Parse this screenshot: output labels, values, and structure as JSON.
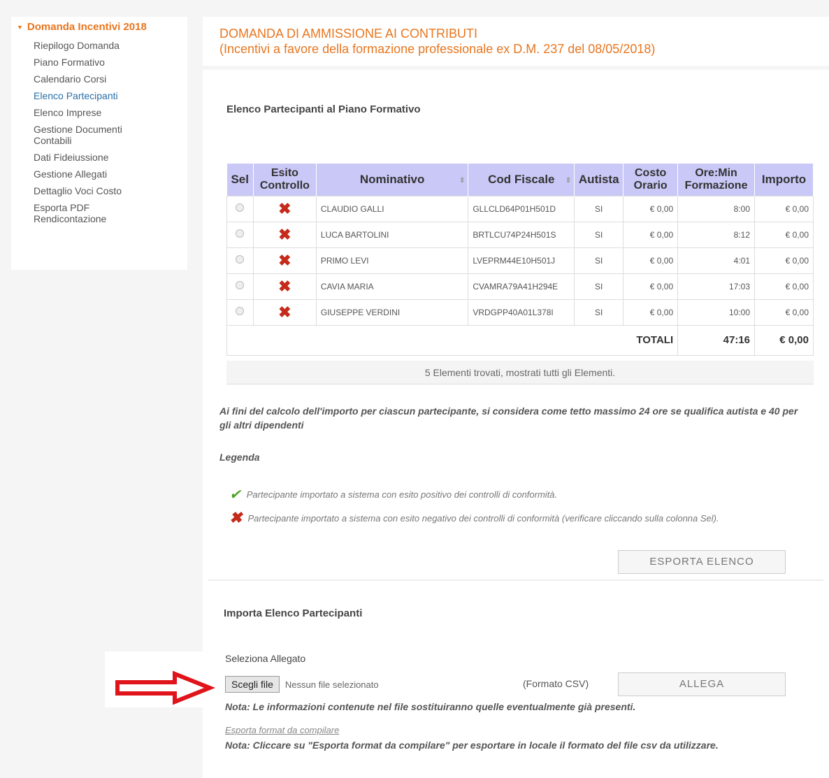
{
  "sidebar": {
    "group_title": "Domanda Incentivi 2018",
    "items": [
      {
        "label": "Riepilogo Domanda"
      },
      {
        "label": "Piano Formativo"
      },
      {
        "label": "Calendario Corsi"
      },
      {
        "label": "Elenco Partecipanti"
      },
      {
        "label": "Elenco Imprese"
      },
      {
        "label": "Gestione Documenti Contabili"
      },
      {
        "label": "Dati Fideiussione"
      },
      {
        "label": "Gestione Allegati"
      },
      {
        "label": "Dettaglio Voci Costo"
      },
      {
        "label": "Esporta PDF Rendicontazione"
      }
    ],
    "active_item": "Elenco Partecipanti"
  },
  "header": {
    "title_line1": "DOMANDA DI AMMISSIONE AI CONTRIBUTI",
    "title_line2": "(Incentivi a favore della formazione professionale ex D.M. 237 del 08/05/2018)"
  },
  "participants": {
    "section_title": "Elenco Partecipanti al Piano Formativo",
    "columns": [
      "Sel",
      "Esito Controllo",
      "Nominativo",
      "Cod Fiscale",
      "Autista",
      "Costo Orario",
      "Ore:Min Formazione",
      "Importo"
    ],
    "rows": [
      {
        "nominativo": "CLAUDIO GALLI",
        "cod_fiscale": "GLLCLD64P01H501D",
        "autista": "SI",
        "costo": "€ 0,00",
        "ore": "8:00",
        "importo": "€ 0,00"
      },
      {
        "nominativo": "LUCA BARTOLINI",
        "cod_fiscale": "BRTLCU74P24H501S",
        "autista": "SI",
        "costo": "€ 0,00",
        "ore": "8:12",
        "importo": "€ 0,00"
      },
      {
        "nominativo": "PRIMO LEVI",
        "cod_fiscale": "LVEPRM44E10H501J",
        "autista": "SI",
        "costo": "€ 0,00",
        "ore": "4:01",
        "importo": "€ 0,00"
      },
      {
        "nominativo": "CAVIA MARIA",
        "cod_fiscale": "CVAMRA79A41H294E",
        "autista": "SI",
        "costo": "€ 0,00",
        "ore": "17:03",
        "importo": "€ 0,00"
      },
      {
        "nominativo": "GIUSEPPE VERDINI",
        "cod_fiscale": "VRDGPP40A01L378I",
        "autista": "SI",
        "costo": "€ 0,00",
        "ore": "10:00",
        "importo": "€ 0,00"
      }
    ],
    "esito_icon": "x-mark-icon",
    "totals_label": "TOTALI",
    "totals_ore": "47:16",
    "totals_importo": "€ 0,00",
    "found_text": "5 Elementi trovati, mostrati tutti gli Elementi."
  },
  "notes": {
    "calc_note": "Ai fini del calcolo dell'importo per ciascun partecipante, si considera come tetto massimo 24 ore se qualifica autista e 40 per gli altri dipendenti",
    "legenda_label": "Legenda",
    "legend_positive": "Partecipante importato a sistema con esito positivo dei controlli di conformità.",
    "legend_negative": "Partecipante importato a sistema con esito negativo dei controlli di conformità (verificare cliccando sulla colonna Sel).",
    "export_button": "ESPORTA ELENCO"
  },
  "import": {
    "section_title": "Importa Elenco Partecipanti",
    "select_label": "Seleziona Allegato",
    "file_button": "Scegli file",
    "file_status": "Nessun file selezionato",
    "format_label": "(Formato CSV)",
    "attach_button": "ALLEGA",
    "replace_note": "Nota: Le informazioni contenute nel file sostituiranno quelle eventualmente già presenti.",
    "export_format_link": "Esporta format da compilare",
    "export_format_note": "Nota: Cliccare su \"Esporta format da compilare\" per esportare in locale il formato del file csv da utilizzare."
  },
  "colors": {
    "accent": "#e8761f",
    "table_header": "#c9c8f7",
    "error": "#c52a1b",
    "success": "#4aa21e",
    "annotation_arrow": "#e0141b"
  }
}
